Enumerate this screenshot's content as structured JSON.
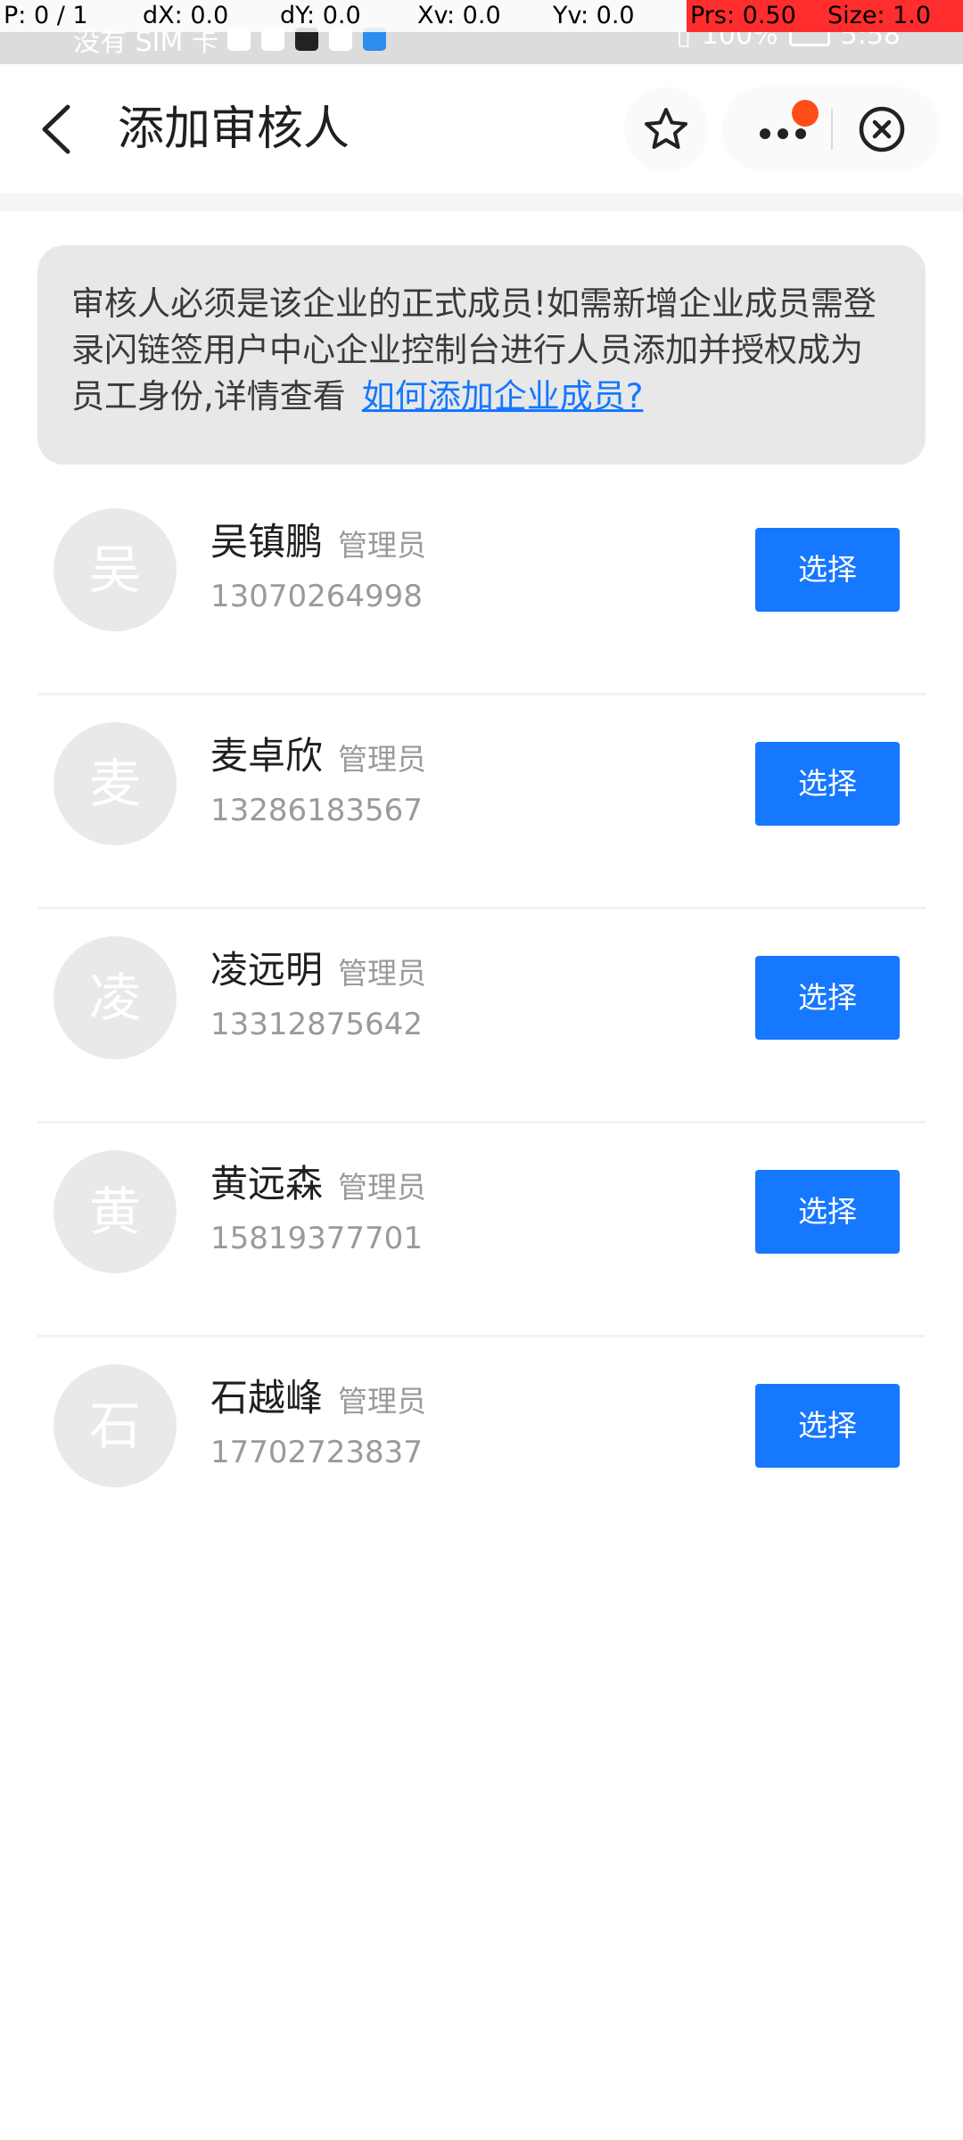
{
  "debug_overlay": {
    "p": "P: 0 / 1",
    "dx": "dX: 0.0",
    "dy": "dY: 0.0",
    "xv": "Xv: 0.0",
    "yv": "Yv: 0.0",
    "prs": "Prs: 0.50",
    "size": "Size: 1.0"
  },
  "status_bar": {
    "carrier": "没有 SIM 卡",
    "battery": "100%",
    "time": "5:58"
  },
  "nav": {
    "title": "添加审核人"
  },
  "notice": {
    "text": "审核人必须是该企业的正式成员!如需新增企业成员需登录闪链签用户中心企业控制台进行人员添加并授权成为员工身份,详情查看",
    "link": "如何添加企业成员?"
  },
  "members": [
    {
      "avatar": "吴",
      "name": "吴镇鹏",
      "role": "管理员",
      "phone": "13070264998",
      "action": "选择"
    },
    {
      "avatar": "麦",
      "name": "麦卓欣",
      "role": "管理员",
      "phone": "13286183567",
      "action": "选择"
    },
    {
      "avatar": "凌",
      "name": "凌远明",
      "role": "管理员",
      "phone": "13312875642",
      "action": "选择"
    },
    {
      "avatar": "黄",
      "name": "黄远森",
      "role": "管理员",
      "phone": "15819377701",
      "action": "选择"
    },
    {
      "avatar": "石",
      "name": "石越峰",
      "role": "管理员",
      "phone": "17702723837",
      "action": "选择"
    }
  ],
  "colors": {
    "accent": "#1677ff",
    "badge": "#ff4d1a",
    "notice_bg": "#e8e8e8",
    "avatar_bg": "#e9e9e9"
  }
}
